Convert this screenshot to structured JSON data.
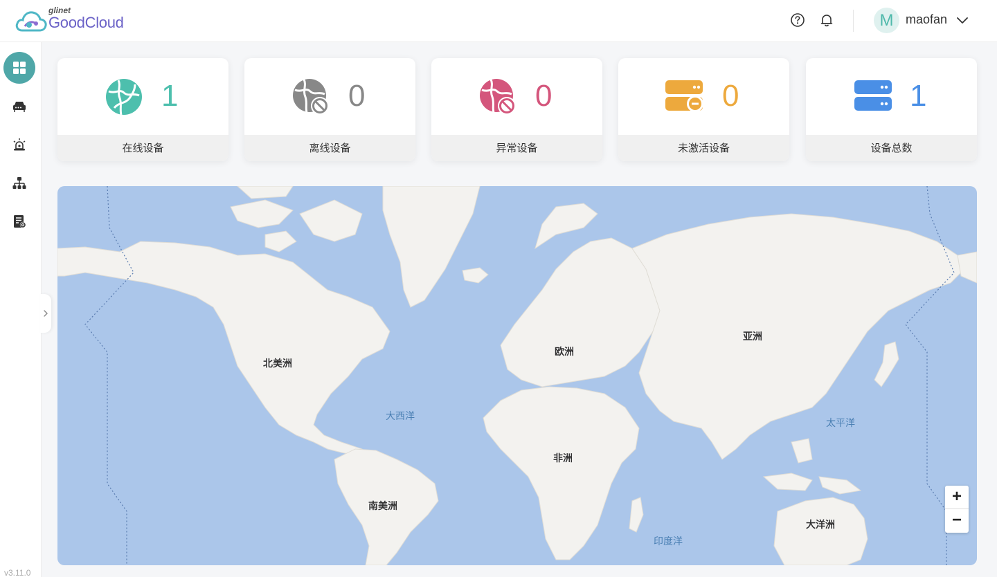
{
  "header": {
    "logo_small": "glinet",
    "logo_big": "GoodCloud",
    "avatar_initial": "M",
    "username": "maofan"
  },
  "sidebar": {
    "items": [
      {
        "icon": "dashboard-icon",
        "active": true
      },
      {
        "icon": "router-device-icon",
        "active": false
      },
      {
        "icon": "alarm-icon",
        "active": false
      },
      {
        "icon": "org-tree-icon",
        "active": false
      },
      {
        "icon": "report-settings-icon",
        "active": false
      }
    ],
    "version": "v3.11.0"
  },
  "stats": [
    {
      "label": "在线设备",
      "value": "1",
      "color": "#4dbfad",
      "icon": "online-globe-icon"
    },
    {
      "label": "离线设备",
      "value": "0",
      "color": "#888888",
      "icon": "offline-globe-icon"
    },
    {
      "label": "异常设备",
      "value": "0",
      "color": "#d4567c",
      "icon": "abnormal-globe-icon"
    },
    {
      "label": "未激活设备",
      "value": "0",
      "color": "#eda93d",
      "icon": "inactive-server-icon"
    },
    {
      "label": "设备总数",
      "value": "1",
      "color": "#4a8fe6",
      "icon": "total-server-icon"
    }
  ],
  "map": {
    "labels": {
      "north_america": "北美洲",
      "europe": "欧洲",
      "asia": "亚洲",
      "africa": "非洲",
      "south_america": "南美洲",
      "oceania": "大洋洲",
      "atlantic": "大西洋",
      "pacific": "太平洋",
      "indian": "印度洋"
    },
    "zoom_in": "+",
    "zoom_out": "−",
    "ocean_color": "#abc6ea",
    "land_color": "#f3f2ef"
  }
}
